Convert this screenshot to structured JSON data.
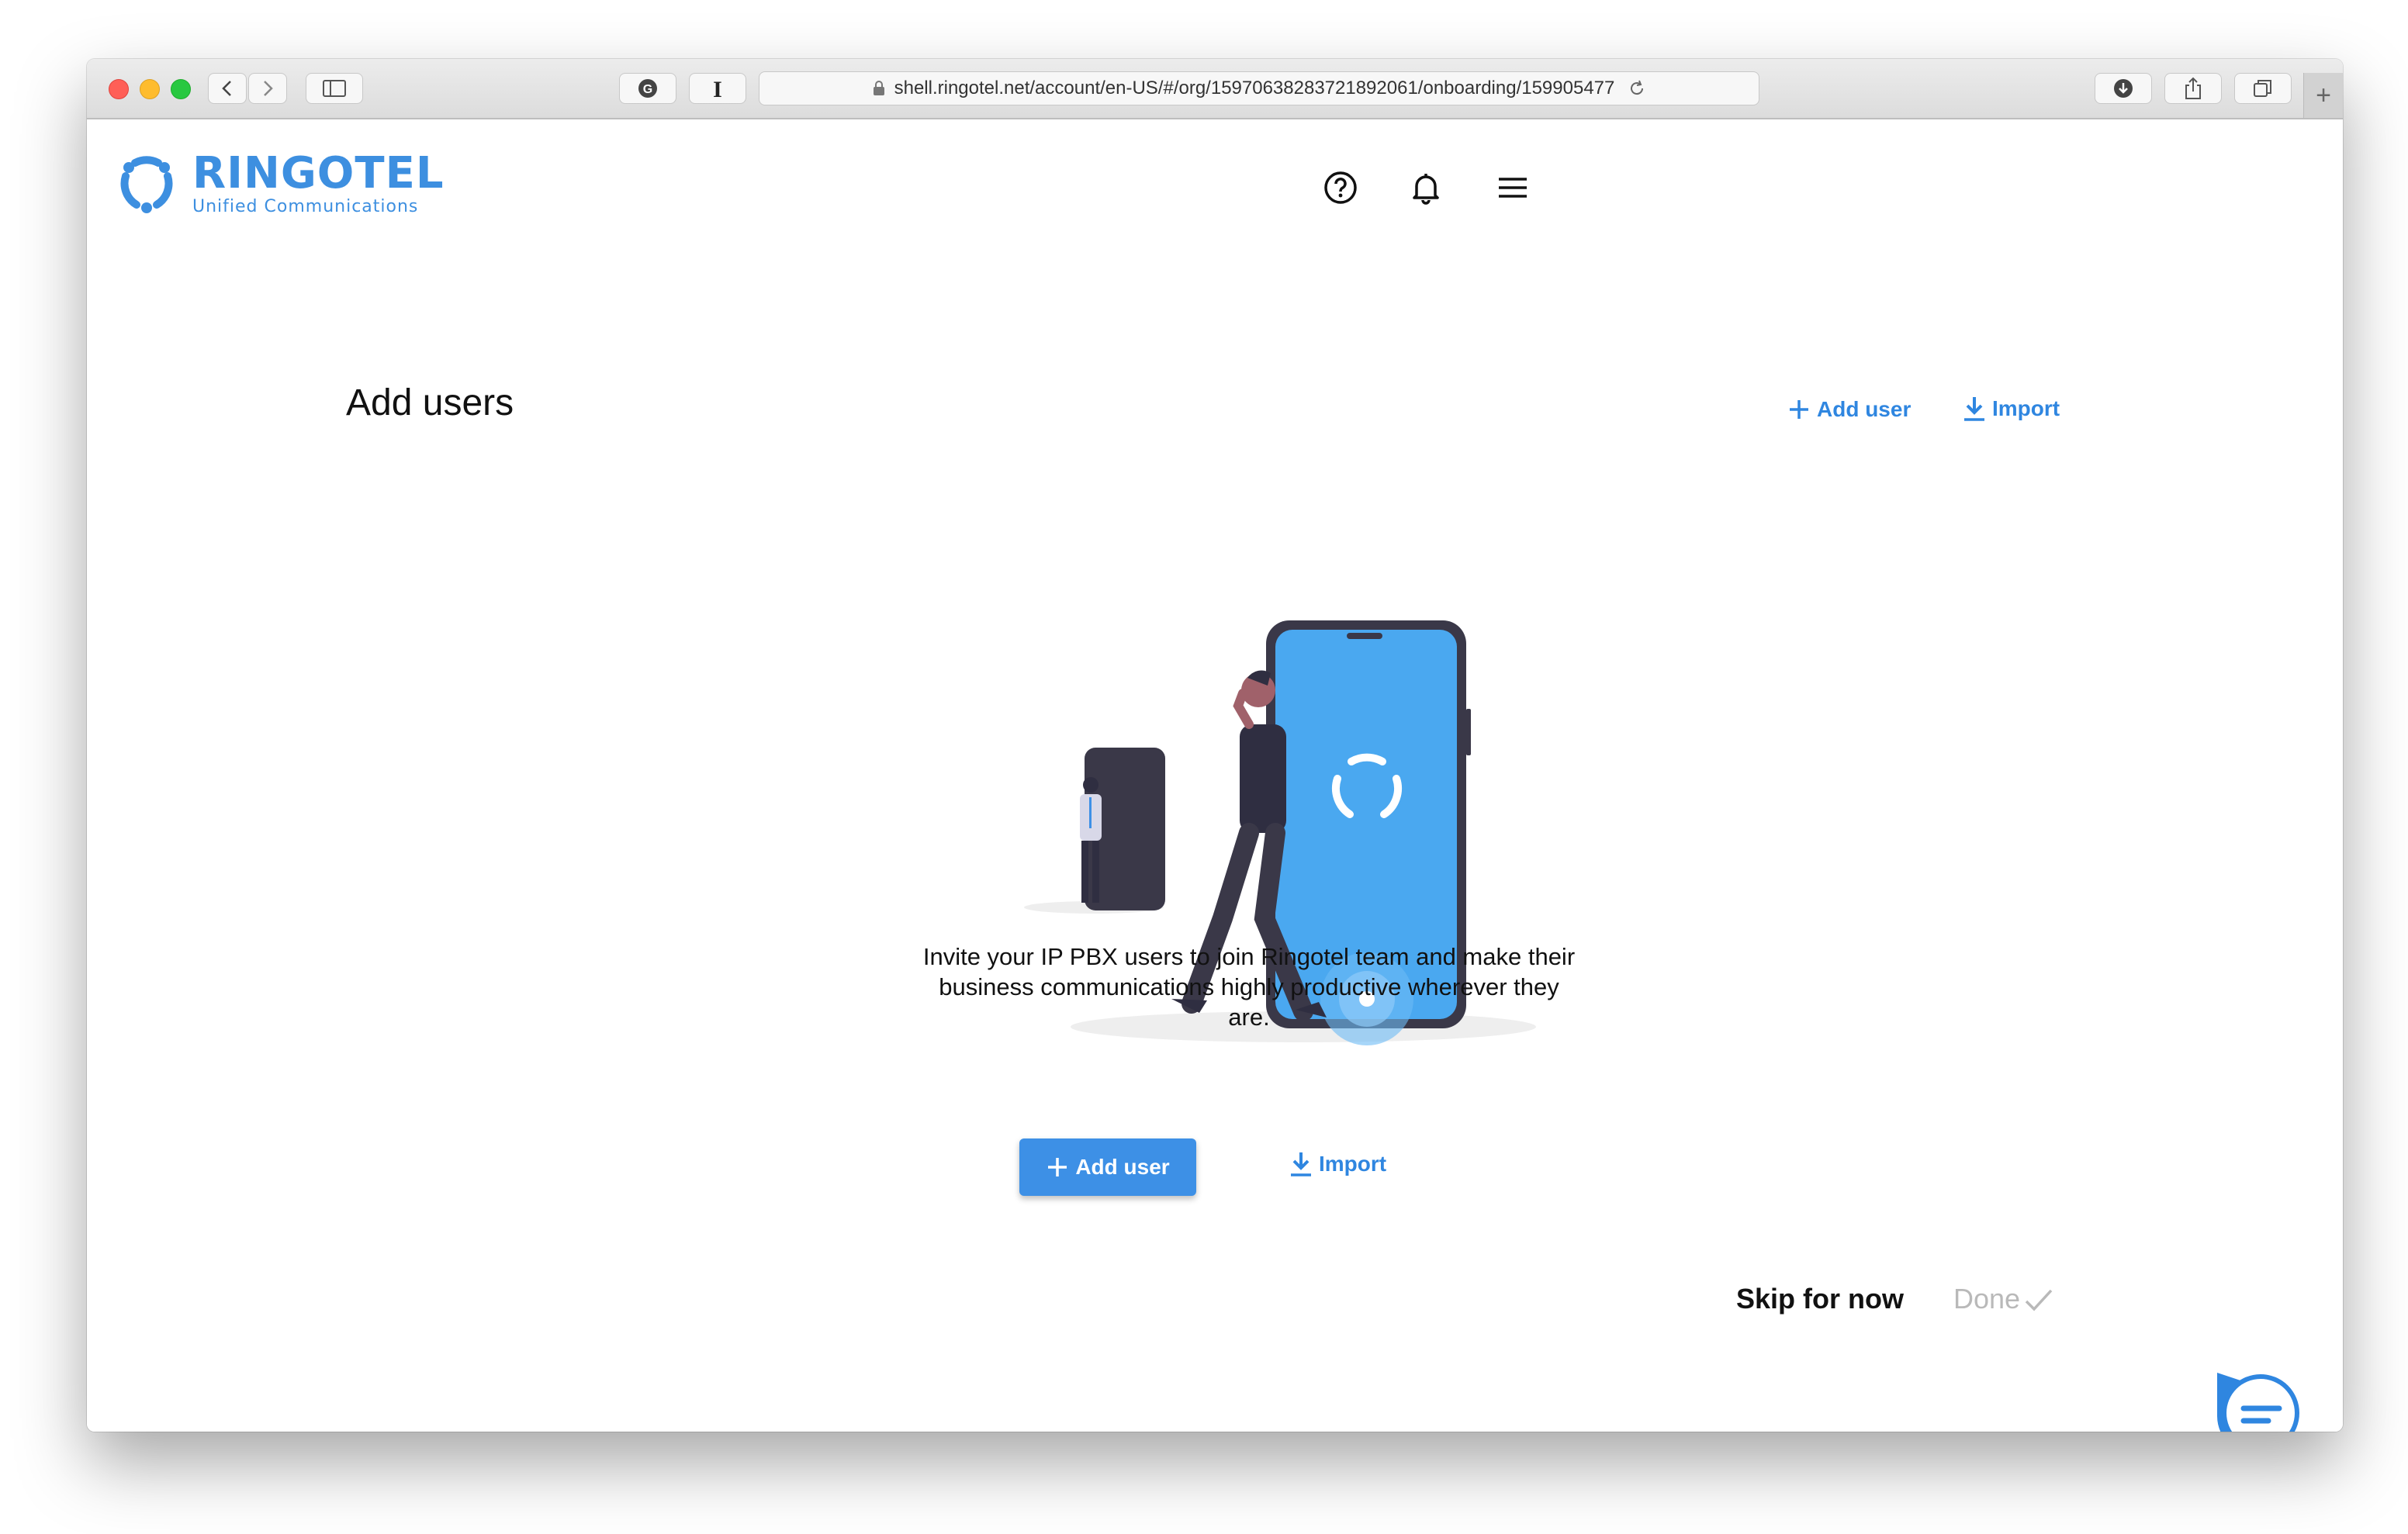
{
  "browser": {
    "url": "shell.ringotel.net/account/en-US/#/org/15970638283721892061/onboarding/159905477",
    "new_tab_label": "+"
  },
  "header": {
    "brand": "RINGOTEL",
    "tagline": "Unified Communications",
    "icons": [
      "help-icon",
      "bell-icon",
      "menu-icon"
    ]
  },
  "main": {
    "title": "Add users",
    "top_actions": {
      "add_user": "Add user",
      "import": "Import"
    },
    "description": "Invite your IP PBX users to join Ringotel team and make their business communications highly productive wherever they are.",
    "center_actions": {
      "add_user": "Add user",
      "import": "Import"
    }
  },
  "footer": {
    "skip": "Skip for now",
    "done": "Done"
  },
  "colors": {
    "accent": "#3d90e6",
    "link": "#2f86e0",
    "disabled": "#b9b9b9",
    "phone_screen": "#4aa8f0",
    "dark": "#3a3848"
  }
}
